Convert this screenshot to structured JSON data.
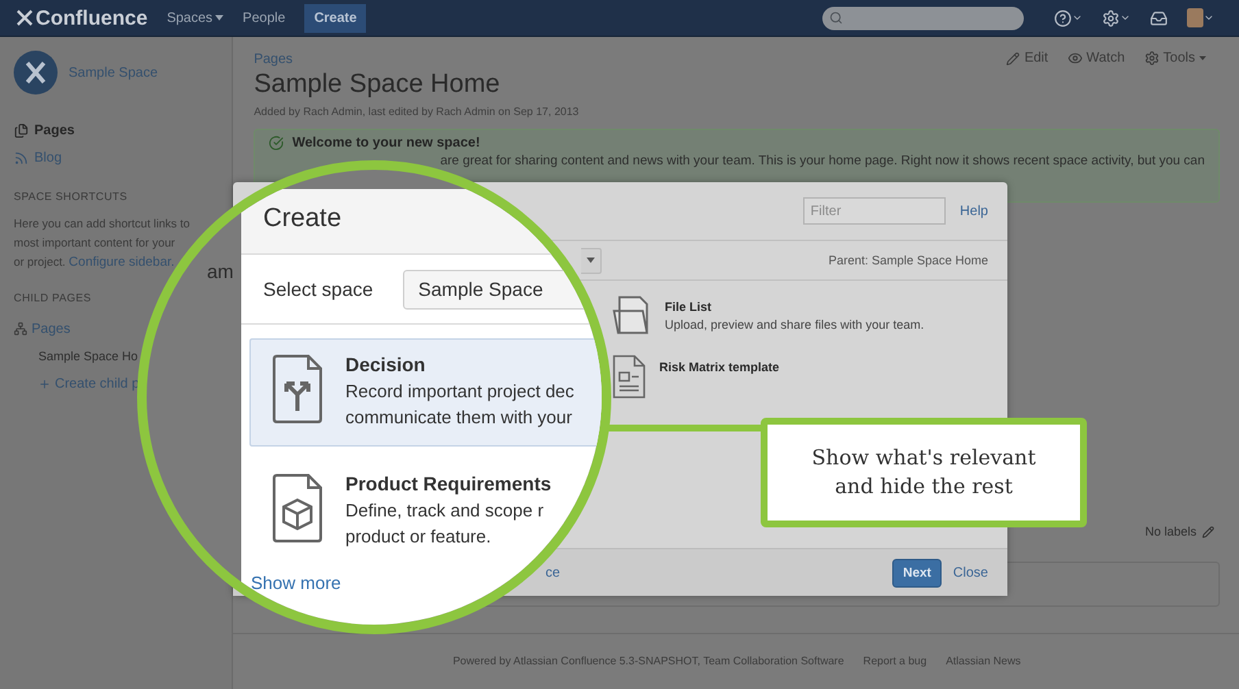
{
  "top_nav": {
    "logo": "Confluence",
    "items": [
      {
        "label": "Spaces",
        "kind": "dropdown"
      },
      {
        "label": "People",
        "kind": "link"
      },
      {
        "label": "Create",
        "kind": "button"
      }
    ]
  },
  "sidebar": {
    "space_name": "Sample Space",
    "nav": [
      {
        "label": "Pages",
        "kind": "pages",
        "selected": true
      },
      {
        "label": "Blog",
        "kind": "blog",
        "selected": false
      }
    ],
    "shortcuts_heading": "SPACE SHORTCUTS",
    "shortcuts_lines": [
      "Here you can add shortcut links to",
      "most important content for your",
      "or project."
    ],
    "configure_link": "Configure sidebar.",
    "child_pages_heading": "CHILD PAGES",
    "tree": [
      {
        "label": "Pages",
        "children": [
          {
            "label": "Sample Space Ho"
          }
        ]
      }
    ],
    "create_child": "Create child p"
  },
  "page": {
    "breadcrumb": "Pages",
    "title": "Sample Space Home",
    "byline": "Added by Rach Admin, last edited by Rach Admin on Sep 17, 2013",
    "actions": [
      {
        "label": "Edit",
        "kind": "edit"
      },
      {
        "label": "Watch",
        "kind": "watch"
      },
      {
        "label": "Tools",
        "kind": "tools"
      }
    ],
    "welcome": {
      "title": "Welcome to your new space!",
      "text": "are great for sharing content and news with your team. This is your home page. Right now it shows recent space activity, but you can"
    },
    "labels": "No labels",
    "footer": [
      "Powered by Atlassian Confluence 5.3-SNAPSHOT, Team Collaboration Software",
      "Report a bug",
      "Atlassian News"
    ]
  },
  "dialog": {
    "filter": {
      "placeholder": "Filter"
    },
    "help": "Help",
    "parent": "Parent: Sample Space Home",
    "templates": [
      {
        "name": "File List",
        "description": "Upload, preview and share files with your team.",
        "kind": "folder"
      },
      {
        "name": "Risk Matrix template",
        "kind": "document"
      }
    ],
    "footer_fragment": "ce",
    "next": "Next",
    "close": "Close"
  },
  "magnifier": {
    "background_fragment": "am",
    "title": "Create",
    "select_label": "Select space",
    "select_value": "Sample Space",
    "items": [
      {
        "name": "Decision",
        "lines": [
          "Record important project dec",
          "communicate them with your"
        ],
        "kind": "decision",
        "selected": true
      },
      {
        "name": "Product Requirements",
        "lines": [
          "Define, track and scope r",
          "product or feature."
        ],
        "kind": "requirements",
        "selected": false
      }
    ],
    "show_more": "Show more"
  },
  "callout": {
    "text": "Show what's relevant and hide the rest"
  }
}
